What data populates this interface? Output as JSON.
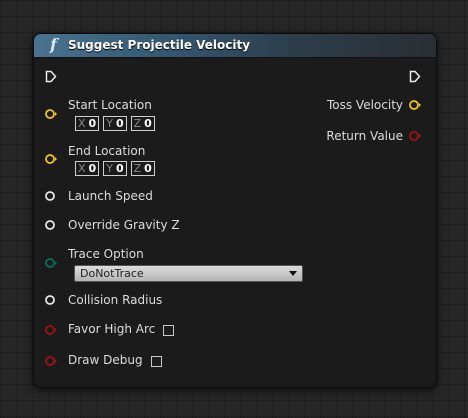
{
  "node": {
    "title": "Suggest Projectile Velocity",
    "icon": "function-icon",
    "inputs": {
      "start_location": {
        "label": "Start Location",
        "x_axis": "X",
        "x": "0",
        "y_axis": "Y",
        "y": "0",
        "z_axis": "Z",
        "z": "0"
      },
      "end_location": {
        "label": "End Location",
        "x_axis": "X",
        "x": "0",
        "y_axis": "Y",
        "y": "0",
        "z_axis": "Z",
        "z": "0"
      },
      "launch_speed": {
        "label": "Launch Speed"
      },
      "override_gravity_z": {
        "label": "Override Gravity Z"
      },
      "trace_option": {
        "label": "Trace Option",
        "selected": "DoNotTrace"
      },
      "collision_radius": {
        "label": "Collision Radius"
      },
      "favor_high_arc": {
        "label": "Favor High Arc",
        "checked": false
      },
      "draw_debug": {
        "label": "Draw Debug",
        "checked": false
      }
    },
    "outputs": {
      "toss_velocity": {
        "label": "Toss Velocity"
      },
      "return_value": {
        "label": "Return Value"
      }
    }
  },
  "colors": {
    "vector_pin": "#f5c518",
    "float_pin": "#e6e6e6",
    "enum_pin": "#0f6b5c",
    "bool_pin": "#9e1414",
    "header": "#3b5f7a"
  }
}
